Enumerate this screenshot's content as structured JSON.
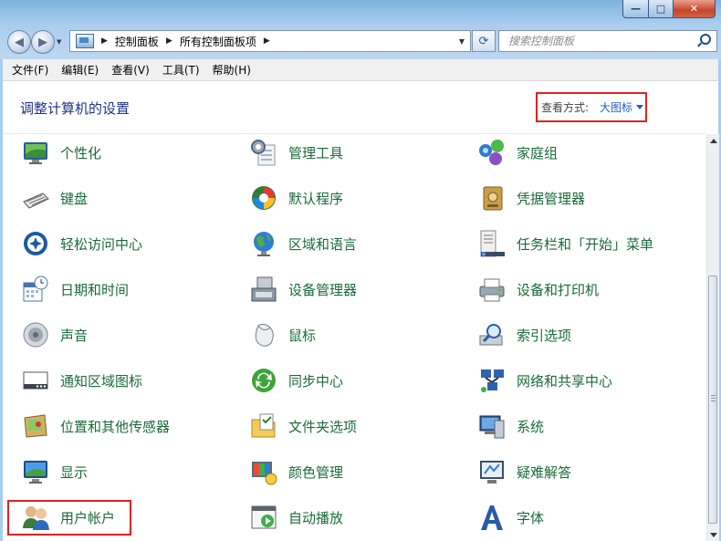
{
  "window": {
    "minimize_glyph": "—",
    "maximize_glyph": "□",
    "close_glyph": "✕"
  },
  "nav": {
    "back_glyph": "◀",
    "forward_glyph": "▶",
    "breadcrumb": [
      "控制面板",
      "所有控制面板项"
    ],
    "separator": "▶",
    "refresh_glyph": "⟳",
    "search_placeholder": "搜索控制面板"
  },
  "menubar": [
    "文件(F)",
    "编辑(E)",
    "查看(V)",
    "工具(T)",
    "帮助(H)"
  ],
  "main": {
    "heading": "调整计算机的设置",
    "view_by_label": "查看方式:",
    "view_by_value": "大图标"
  },
  "items": [
    {
      "label": "个性化",
      "icon": "personalization-icon"
    },
    {
      "label": "管理工具",
      "icon": "admin-tools-icon"
    },
    {
      "label": "家庭组",
      "icon": "homegroup-icon"
    },
    {
      "label": "键盘",
      "icon": "keyboard-icon"
    },
    {
      "label": "默认程序",
      "icon": "default-programs-icon"
    },
    {
      "label": "凭据管理器",
      "icon": "credential-manager-icon"
    },
    {
      "label": "轻松访问中心",
      "icon": "ease-of-access-icon"
    },
    {
      "label": "区域和语言",
      "icon": "region-language-icon"
    },
    {
      "label": "任务栏和「开始」菜单",
      "icon": "taskbar-start-menu-icon"
    },
    {
      "label": "日期和时间",
      "icon": "date-time-icon"
    },
    {
      "label": "设备管理器",
      "icon": "device-manager-icon"
    },
    {
      "label": "设备和打印机",
      "icon": "devices-printers-icon"
    },
    {
      "label": "声音",
      "icon": "sound-icon"
    },
    {
      "label": "鼠标",
      "icon": "mouse-icon"
    },
    {
      "label": "索引选项",
      "icon": "indexing-options-icon"
    },
    {
      "label": "通知区域图标",
      "icon": "notification-area-icon"
    },
    {
      "label": "同步中心",
      "icon": "sync-center-icon"
    },
    {
      "label": "网络和共享中心",
      "icon": "network-sharing-icon"
    },
    {
      "label": "位置和其他传感器",
      "icon": "location-sensors-icon"
    },
    {
      "label": "文件夹选项",
      "icon": "folder-options-icon"
    },
    {
      "label": "系统",
      "icon": "system-icon"
    },
    {
      "label": "显示",
      "icon": "display-icon"
    },
    {
      "label": "颜色管理",
      "icon": "color-management-icon"
    },
    {
      "label": "疑难解答",
      "icon": "troubleshooting-icon"
    },
    {
      "label": "用户帐户",
      "icon": "user-accounts-icon"
    },
    {
      "label": "自动播放",
      "icon": "autoplay-icon"
    },
    {
      "label": "字体",
      "icon": "fonts-icon"
    }
  ],
  "colors": {
    "link_green": "#1a6a3a",
    "heading_blue": "#1e3287",
    "highlight_red": "#e02121"
  }
}
